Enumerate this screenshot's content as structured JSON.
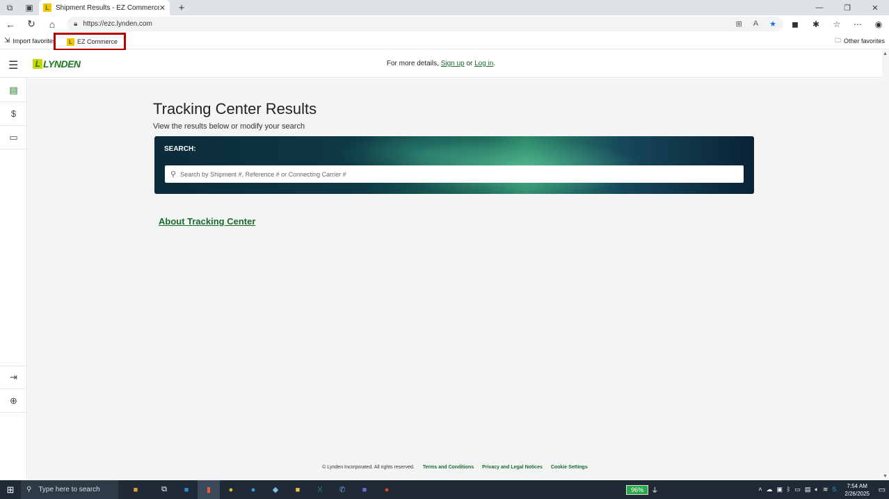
{
  "browser": {
    "tab_title": "Shipment Results - EZ Commerce",
    "tab_favicon": "L",
    "url": "https://ezc.lynden.com",
    "favorites": {
      "import_label": "Import favorites",
      "ez_commerce_label": "EZ Commerce",
      "other_label": "Other favorites"
    }
  },
  "header": {
    "logo_text": "LYNDEN",
    "logo_mark": "L",
    "msg_prefix": "For more details,",
    "signup_label": "Sign up",
    "msg_or": "or",
    "login_label": "Log in",
    "msg_suffix": "."
  },
  "main": {
    "title": "Tracking Center Results",
    "subtitle": "View the results below or modify your search",
    "search_label": "SEARCH:",
    "search_placeholder": "Search by Shipment #, Reference # or Connecting Carrier #",
    "about_link": "About Tracking Center"
  },
  "footer": {
    "copyright": "© Lynden Incorporated. All rights reserved.",
    "terms": "Terms and Conditions",
    "privacy": "Privacy and Legal Notices",
    "cookies": "Cookie Settings"
  },
  "taskbar": {
    "search_placeholder": "Type here to search",
    "battery": "96%",
    "time": "7:54 AM",
    "date": "2/26/2025"
  },
  "colors": {
    "brand_green": "#1a7a1a",
    "highlight_red": "#b30000"
  }
}
